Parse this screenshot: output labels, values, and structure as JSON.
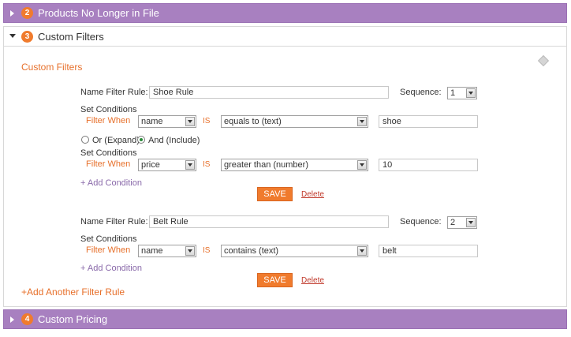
{
  "accordion": {
    "section2": {
      "number": "2",
      "title": "Products No Longer in File"
    },
    "section3": {
      "number": "3",
      "title": "Custom Filters"
    },
    "section4": {
      "number": "4",
      "title": "Custom Pricing"
    }
  },
  "custom_filters": {
    "heading": "Custom Filters",
    "add_another": "+Add Another Filter Rule",
    "labels": {
      "name_filter_rule": "Name Filter Rule:",
      "sequence": "Sequence:",
      "set_conditions": "Set Conditions",
      "filter_when": "Filter When",
      "is": "IS",
      "add_condition": "+ Add Condition",
      "save": "SAVE",
      "delete": "Delete",
      "or_expand": "Or (Expand)",
      "and_include": "And (Include)"
    },
    "rules": [
      {
        "name": "Shoe Rule",
        "sequence": "1",
        "conditions": [
          {
            "field": "name",
            "operator": "equals to (text)",
            "value": "shoe"
          },
          {
            "field": "price",
            "operator": "greater than (number)",
            "value": "10"
          }
        ],
        "logic_selected": "And (Include)"
      },
      {
        "name": "Belt Rule",
        "sequence": "2",
        "conditions": [
          {
            "field": "name",
            "operator": "contains (text)",
            "value": "belt"
          }
        ]
      }
    ]
  },
  "colors": {
    "purple_header": "#a880c0",
    "orange_accent": "#f07b2d"
  }
}
